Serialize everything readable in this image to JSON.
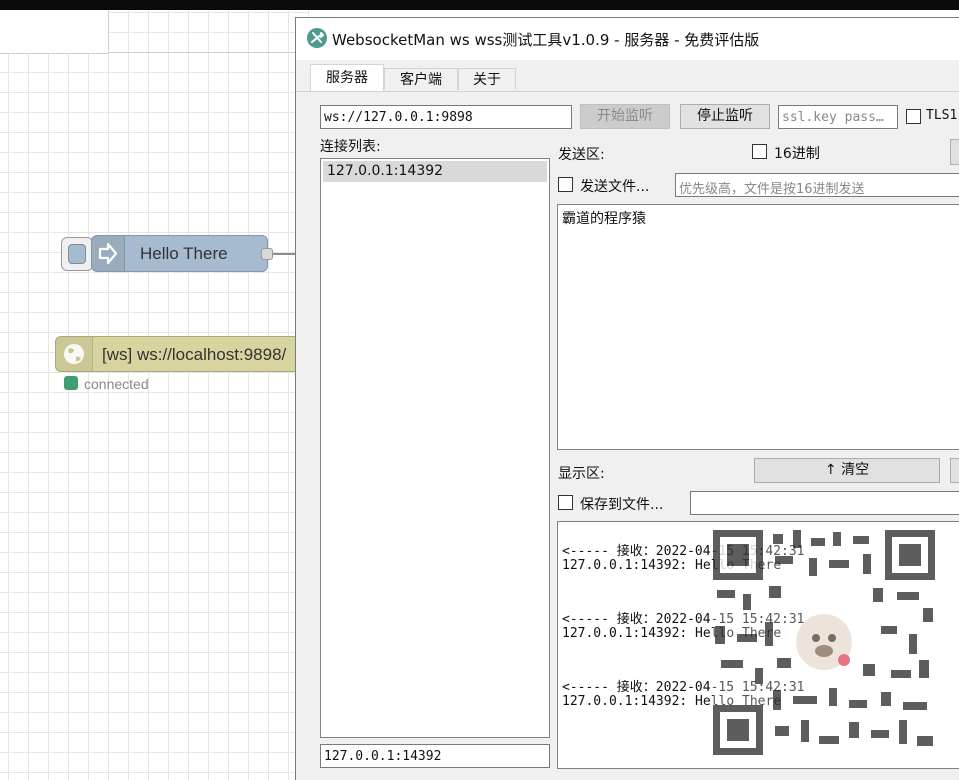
{
  "canvas": {
    "inject_node_label": "Hello There",
    "ws_node_label": "[ws] ws://localhost:9898/",
    "ws_status": "connected"
  },
  "window": {
    "title": "WebsocketMan ws wss测试工具v1.0.9  - 服务器 - 免费评估版",
    "tabs": [
      "服务器",
      "客户端",
      "关于"
    ],
    "active_tab": "服务器"
  },
  "server": {
    "address": "ws://127.0.0.1:9898",
    "start_label": "开始监听",
    "stop_label": "停止监听",
    "ssl_placeholder": "ssl.key pass…",
    "tls_label": "TLS1",
    "connections_label": "连接列表:",
    "connections": [
      "127.0.0.1:14392"
    ],
    "selected_connection": "127.0.0.1:14392"
  },
  "send": {
    "label": "发送区:",
    "hex_label": "16进制",
    "send_file_label": "发送文件...",
    "file_placeholder": "优先级高，文件是按16进制发送",
    "message": "霸道的程序猿"
  },
  "display": {
    "label": "显示区:",
    "clear_label": "清空",
    "save_file_label": "保存到文件...",
    "log": [
      "<----- 接收：2022-04-15 15:42:31",
      "127.0.0.1:14392: Hello There",
      "<----- 接收：2022-04-15 15:42:31",
      "127.0.0.1:14392: Hello There",
      "<----- 接收：2022-04-15 15:42:31",
      "127.0.0.1:14392: Hello There"
    ]
  },
  "colors": {
    "inject_node": "#a6bbcf",
    "ws_node": "#d8d4a0",
    "status_connected": "#3f9f6f",
    "window_bg": "#f0f0f0"
  }
}
